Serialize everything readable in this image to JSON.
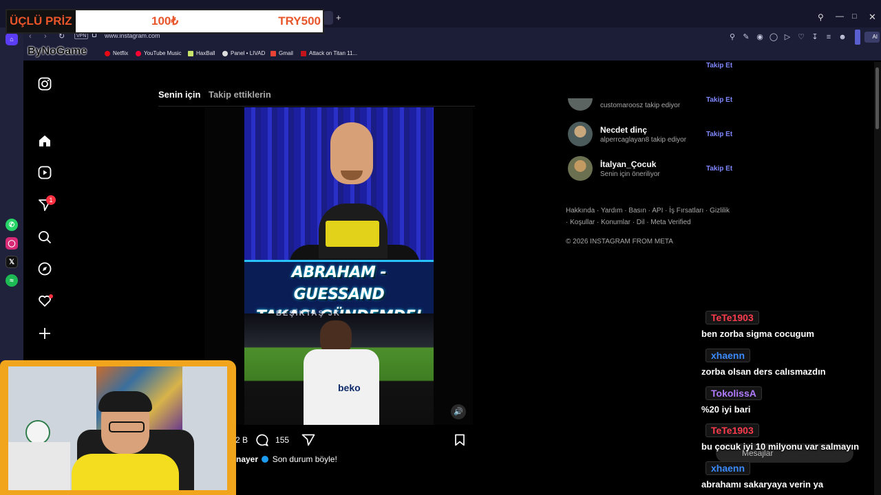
{
  "promo": {
    "product": "ÜÇLÜ PRİZ",
    "price_old": "100₺",
    "price_new": "TRY500"
  },
  "watermark": "ByNoGame",
  "browser": {
    "url": "www.instagram.com",
    "vpn_label": "VPN",
    "ai_label": "AI",
    "bookmarks": [
      "Netflix",
      "YouTube Music",
      "HaxBall",
      "Panel • LIVAD",
      "Gmail",
      "Attack on Titan 11..."
    ]
  },
  "instagram": {
    "notification_count": "1",
    "feed_tabs": [
      "Senin için",
      "Takip ettiklerin"
    ],
    "video": {
      "caption_line1": "ABRAHAM - GUESSAND",
      "caption_line2": "TAKASI GÜNDEMDE!",
      "stadium_text": "BEŞİKTAŞ JK",
      "shirt_brand": "beko"
    },
    "post": {
      "likes": "2 B",
      "comments": "155",
      "author": "nayer",
      "caption": "Son durum böyle!"
    },
    "suggestions": [
      {
        "name": "Necdet dinç",
        "subtitle": "alperrcaglayan8 takip ediyor"
      },
      {
        "name": "İtalyan_Çocuk",
        "subtitle": "Senin için öneriliyor"
      }
    ],
    "partial_suggestion_subtitle": "customaroosz takip ediyor",
    "follow_label": "Takip Et",
    "footer_links": "Hakkında · Yardım · Basın · API · İş Fırsatları · Gizlilik · Koşullar · Konumlar · Dil · Meta Verified",
    "copyright": "© 2026 INSTAGRAM FROM META",
    "messages_label": "Mesajlar"
  },
  "chat": [
    {
      "user": "TeTe1903",
      "text": "ben zorba sigma cocugum",
      "color": "#ff3b4e"
    },
    {
      "user": "xhaenn",
      "text": "zorba olsan ders calısmazdın",
      "color": "#3b8bff"
    },
    {
      "user": "TokolissA",
      "text": "%20 iyi bari",
      "color": "#b07bff"
    },
    {
      "user": "TeTe1903",
      "text": "bu çocuk iyi 10 milyonu var salmayın",
      "color": "#ff3b4e"
    },
    {
      "user": "xhaenn",
      "text": "abrahamı sakaryaya verin ya",
      "color": "#3b8bff"
    }
  ]
}
